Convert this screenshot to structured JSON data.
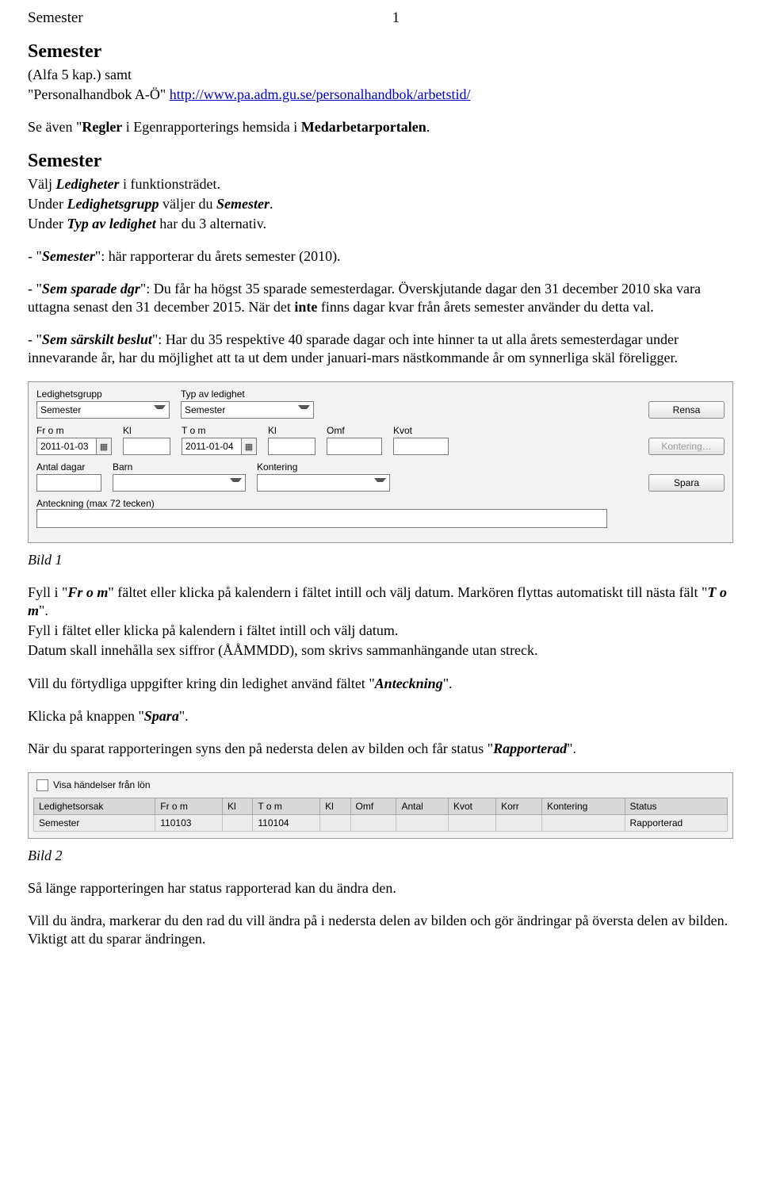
{
  "header": {
    "title": "Semester",
    "page_number": "1"
  },
  "intro": {
    "heading": "Semester",
    "line1_pre": "(Alfa 5 kap.) samt",
    "line2_pre": "\"Personalhandbok A-Ö\" ",
    "link_text": "http://www.pa.adm.gu.se/personalhandbok/arbetstid/",
    "se_aven_pre": "Se även \"",
    "se_aven_b": "Regler",
    "se_aven_mid": " i Egenrapporterings hemsida i ",
    "se_aven_b2": "Medarbetarportalen",
    "se_aven_post": "."
  },
  "section2": {
    "heading": "Semester",
    "p1_pre": "Välj ",
    "p1_bi": "Ledigheter",
    "p1_post": " i funktionsträdet.",
    "p2_pre": "Under ",
    "p2_bi": "Ledighetsgrupp",
    "p2_mid": " väljer du ",
    "p2_bi2": "Semester",
    "p2_post": ".",
    "p3_pre": "Under ",
    "p3_bi": "Typ av ledighet",
    "p3_post": " har du 3 alternativ.",
    "sem_pre": "- \"",
    "sem_bi": "Semester",
    "sem_post": "\": här rapporterar du årets semester (2010).",
    "sparade_pre": "- \"",
    "sparade_bi": "Sem sparade dgr",
    "sparade_post": "\": Du får ha högst 35 sparade semesterdagar. Överskjutande dagar den 31 december 2010 ska vara uttagna senast den 31 december 2015. När det ",
    "sparade_b": "inte",
    "sparade_post2": " finns dagar kvar från årets semester använder du detta val.",
    "sarskilt_pre": "- \"",
    "sarskilt_bi": "Sem särskilt beslut",
    "sarskilt_post": "\": Har du 35 respektive 40 sparade dagar och inte hinner ta ut alla årets semesterdagar under innevarande år, har du möjlighet att ta ut dem under januari-mars nästkommande år om synnerliga skäl föreligger."
  },
  "form": {
    "labels": {
      "ledighetsgrupp": "Ledighetsgrupp",
      "typ": "Typ av ledighet",
      "from": "Fr o m",
      "kl1": "Kl",
      "tom": "T o m",
      "kl2": "Kl",
      "omf": "Omf",
      "kvot": "Kvot",
      "antal": "Antal dagar",
      "barn": "Barn",
      "kontering": "Kontering",
      "anteckning": "Anteckning (max 72 tecken)"
    },
    "values": {
      "ledighetsgrupp": "Semester",
      "typ": "Semester",
      "from": "2011-01-03",
      "tom": "2011-01-04"
    },
    "buttons": {
      "rensa": "Rensa",
      "kontering": "Kontering…",
      "spara": "Spara"
    }
  },
  "bild1_caption": "Bild 1",
  "after_bild1": {
    "p1a": "Fyll i \"",
    "p1bi": "Fr o m",
    "p1b": "\" fältet  eller klicka på kalendern i fältet intill och välj datum. Markören flyttas automatiskt till nästa fält \"",
    "p1bi2": "T o m",
    "p1c": "\".",
    "p2": "Fyll i fältet eller klicka på kalendern i fältet intill och välj datum.",
    "p3": "Datum skall innehålla sex siffror (ÅÅMMDD), som skrivs sammanhängande utan streck.",
    "p4a": "Vill du förtydliga uppgifter kring din ledighet använd fältet \"",
    "p4bi": "Anteckning",
    "p4b": "\".",
    "p5a": "Klicka på knappen \"",
    "p5bi": "Spara",
    "p5b": "\".",
    "p6a": "När du sparat rapporteringen syns den på nedersta delen av bilden och får status \"",
    "p6bi": "Rapporterad",
    "p6b": "\"."
  },
  "table": {
    "checkbox_label": "Visa händelser från lön",
    "headers": [
      "Ledighetsorsak",
      "Fr o m",
      "Kl",
      "T o m",
      "Kl",
      "Omf",
      "Antal",
      "Kvot",
      "Korr",
      "Kontering",
      "Status"
    ],
    "row": [
      "Semester",
      "110103",
      "",
      "110104",
      "",
      "",
      "",
      "",
      "",
      "",
      "Rapporterad"
    ]
  },
  "bild2_caption": "Bild 2",
  "after_bild2": {
    "p1": "Så länge rapporteringen har status rapporterad kan du ändra den.",
    "p2": "Vill du ändra, markerar du den rad du vill ändra på i nedersta delen av bilden och gör ändringar på översta delen av bilden. Viktigt att du sparar ändringen."
  }
}
